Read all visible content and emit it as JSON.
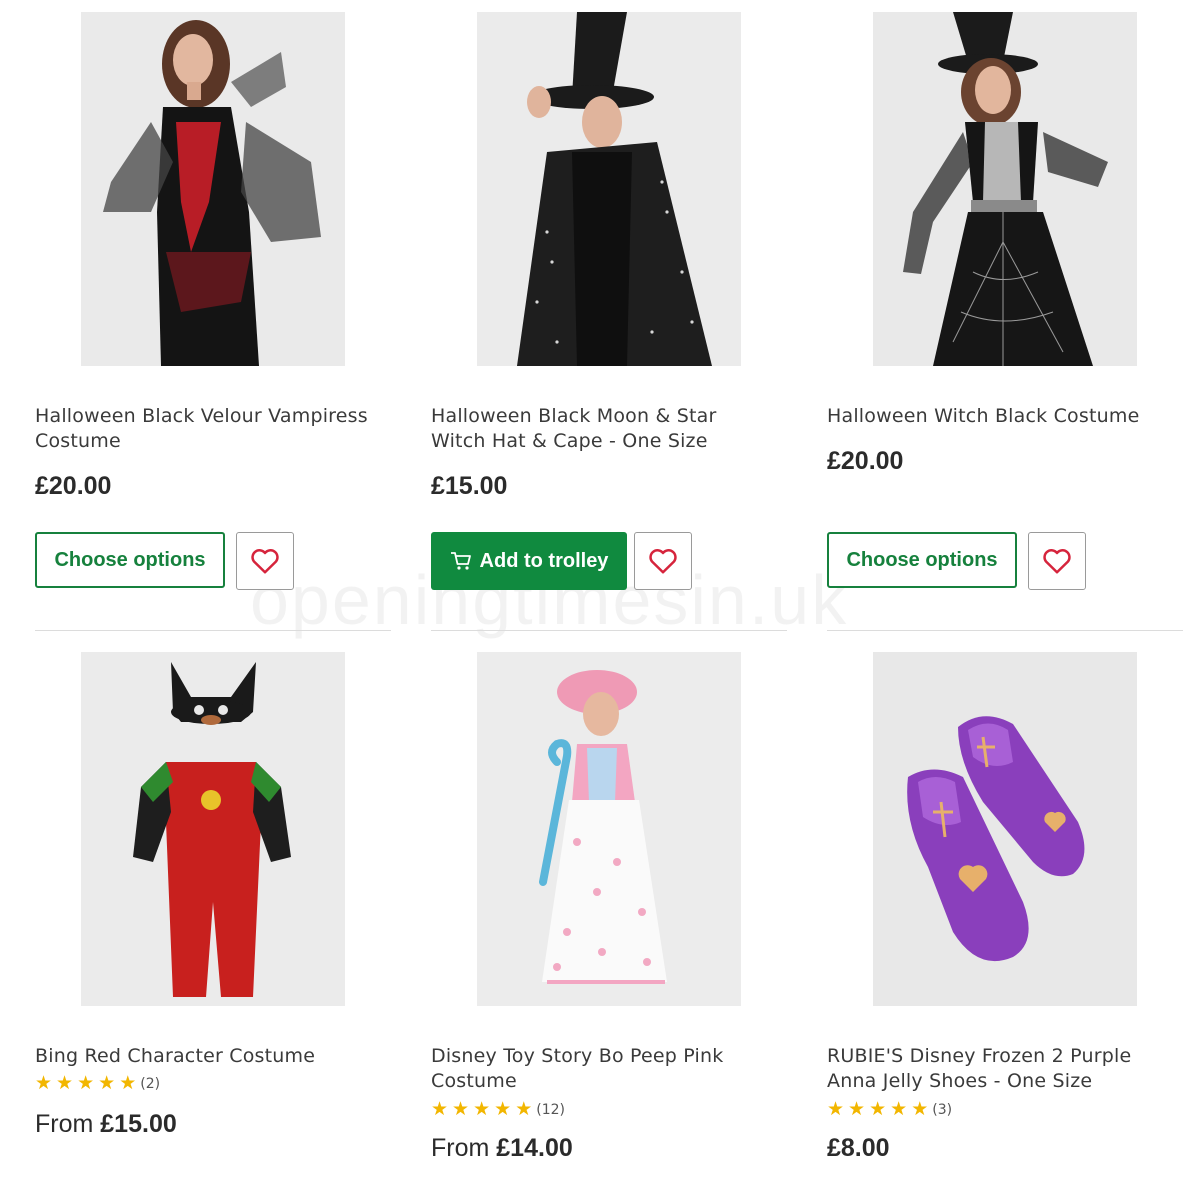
{
  "products": [
    {
      "title": "Halloween Black Velour Vampiress Costume",
      "price": "£20.00",
      "button": "Choose options"
    },
    {
      "title": "Halloween Black Moon & Star Witch Hat & Cape - One Size",
      "price": "£15.00",
      "button": "Add to trolley"
    },
    {
      "title": "Halloween Witch Black Costume",
      "price": "£20.00",
      "button": "Choose options"
    },
    {
      "title": "Bing Red Character Costume",
      "rating_count": "(2)",
      "price_prefix": "From",
      "price": "£15.00"
    },
    {
      "title": "Disney Toy Story Bo Peep Pink Costume",
      "rating_count": "(12)",
      "price_prefix": "From",
      "price": "£14.00"
    },
    {
      "title": "RUBIE'S Disney Frozen 2 Purple Anna Jelly Shoes - One Size",
      "rating_count": "(3)",
      "price": "£8.00"
    }
  ],
  "icons": {
    "wishlist": "heart-icon",
    "cart": "trolley-icon",
    "rating": "star-icon"
  },
  "colors": {
    "primary_green": "#108a3f",
    "heart_red": "#d6243c",
    "star_yellow": "#f2b600"
  },
  "watermark": "openingtimesin.uk"
}
